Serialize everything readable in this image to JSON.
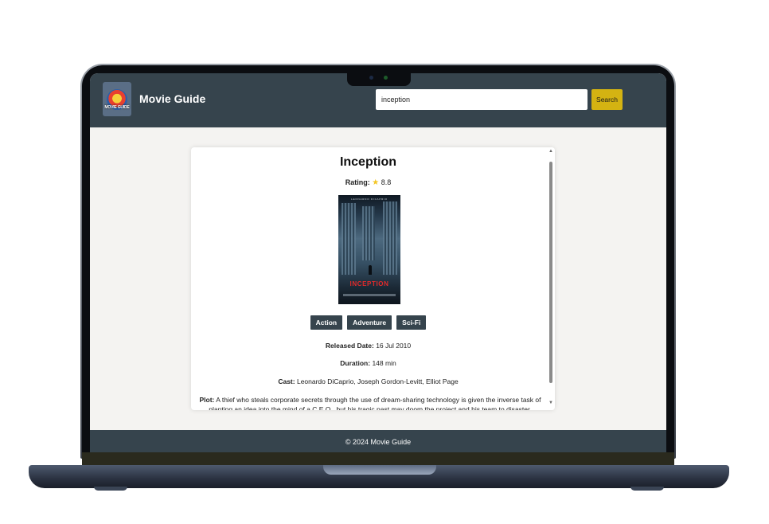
{
  "header": {
    "logo_text": "MOVIE GUIDE",
    "brand": "Movie Guide",
    "search_value": "inception",
    "search_button": "Search"
  },
  "movie": {
    "title": "Inception",
    "rating_label": "Rating:",
    "rating_value": "8.8",
    "poster_title": "INCEPTION",
    "poster_top": "LEONARDO DICAPRIO",
    "genres": [
      "Action",
      "Adventure",
      "Sci-Fi"
    ],
    "released_label": "Released Date:",
    "released_value": "16 Jul 2010",
    "duration_label": "Duration:",
    "duration_value": "148 min",
    "cast_label": "Cast:",
    "cast_value": "Leonardo DiCaprio, Joseph Gordon-Levitt, Elliot Page",
    "plot_label": "Plot:",
    "plot_value": "A thief who steals corporate secrets through the use of dream-sharing technology is given the inverse task of planting an idea into the mind of a C.E.O., but his tragic past may doom the project and his team to disaster."
  },
  "footer": {
    "text": "© 2024 Movie Guide"
  },
  "colors": {
    "header_bg": "#36444d",
    "accent": "#d4b312",
    "page_bg": "#f4f3f1",
    "star": "#f3c623"
  },
  "icons": {
    "rating": "star-icon",
    "scroll_up": "arrow-up-icon",
    "scroll_down": "arrow-down-icon"
  }
}
